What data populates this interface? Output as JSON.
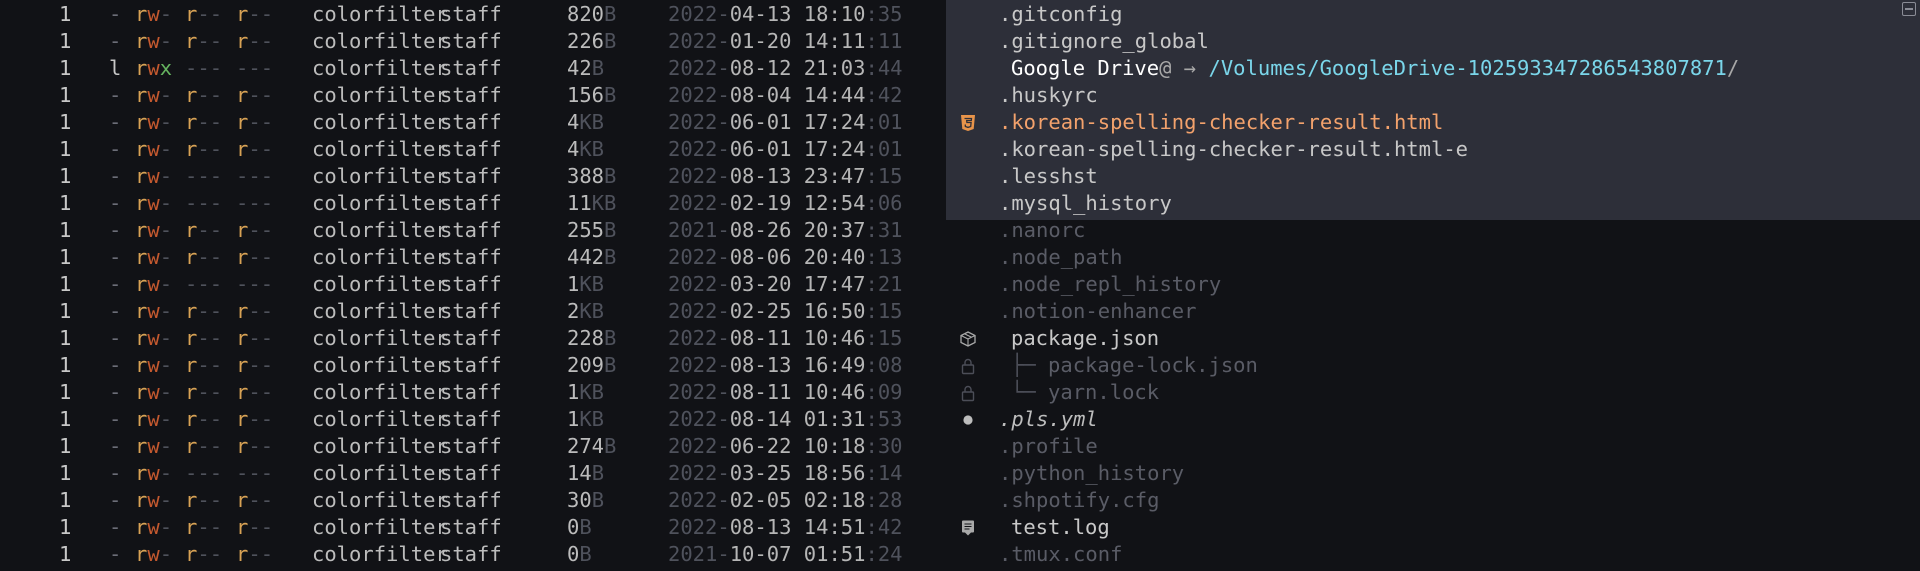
{
  "listing": [
    {
      "links": "1",
      "type": "-",
      "perm": [
        "rw-",
        "r--",
        "r--"
      ],
      "user": "colorfilter",
      "group": "staff",
      "size": "820",
      "unit": "B",
      "date_pre": "2022-",
      "date_main": "04-13 18:10",
      "date_sec": ":35",
      "icon": "none",
      "name": ".gitconfig",
      "style": "plain"
    },
    {
      "links": "1",
      "type": "-",
      "perm": [
        "rw-",
        "r--",
        "r--"
      ],
      "user": "colorfilter",
      "group": "staff",
      "size": "226",
      "unit": "B",
      "date_pre": "2022-",
      "date_main": "01-20 14:11",
      "date_sec": ":11",
      "icon": "none",
      "name": ".gitignore_global",
      "style": "plain"
    },
    {
      "links": "1",
      "type": "l",
      "perm": [
        "rwx",
        "---",
        "---"
      ],
      "user": "colorfilter",
      "group": "staff",
      "size": "42",
      "unit": "B",
      "date_pre": "2022-",
      "date_main": "08-12 21:03",
      "date_sec": ":44",
      "icon": "none",
      "name": "Google Drive",
      "link_mark": "@",
      "arrow": "→",
      "target": "/Volumes/GoogleDrive-102593347286543807871",
      "target_slash": "/",
      "style": "link"
    },
    {
      "links": "1",
      "type": "-",
      "perm": [
        "rw-",
        "r--",
        "r--"
      ],
      "user": "colorfilter",
      "group": "staff",
      "size": "156",
      "unit": "B",
      "date_pre": "2022-",
      "date_main": "08-04 14:44",
      "date_sec": ":42",
      "icon": "none",
      "name": ".huskyrc",
      "style": "plain"
    },
    {
      "links": "1",
      "type": "-",
      "perm": [
        "rw-",
        "r--",
        "r--"
      ],
      "user": "colorfilter",
      "group": "staff",
      "size": "4",
      "unit": "KB",
      "date_pre": "2022-",
      "date_main": "06-01 17:24",
      "date_sec": ":01",
      "icon": "html5-icon",
      "name": ".korean-spelling-checker-result.html",
      "style": "html"
    },
    {
      "links": "1",
      "type": "-",
      "perm": [
        "rw-",
        "r--",
        "r--"
      ],
      "user": "colorfilter",
      "group": "staff",
      "size": "4",
      "unit": "KB",
      "date_pre": "2022-",
      "date_main": "06-01 17:24",
      "date_sec": ":01",
      "icon": "none",
      "name": ".korean-spelling-checker-result.html-e",
      "style": "plain"
    },
    {
      "links": "1",
      "type": "-",
      "perm": [
        "rw-",
        "---",
        "---"
      ],
      "user": "colorfilter",
      "group": "staff",
      "size": "388",
      "unit": "B",
      "date_pre": "2022-",
      "date_main": "08-13 23:47",
      "date_sec": ":15",
      "icon": "none",
      "name": ".lesshst",
      "style": "plain"
    },
    {
      "links": "1",
      "type": "-",
      "perm": [
        "rw-",
        "---",
        "---"
      ],
      "user": "colorfilter",
      "group": "staff",
      "size": "11",
      "unit": "KB",
      "date_pre": "2022-",
      "date_main": "02-19 12:54",
      "date_sec": ":06",
      "icon": "none",
      "name": ".mysql_history",
      "style": "plain"
    },
    {
      "links": "1",
      "type": "-",
      "perm": [
        "rw-",
        "r--",
        "r--"
      ],
      "user": "colorfilter",
      "group": "staff",
      "size": "255",
      "unit": "B",
      "date_pre": "2021-",
      "date_main": "08-26 20:37",
      "date_sec": ":31",
      "icon": "none",
      "name": ".nanorc",
      "style": "dim"
    },
    {
      "links": "1",
      "type": "-",
      "perm": [
        "rw-",
        "r--",
        "r--"
      ],
      "user": "colorfilter",
      "group": "staff",
      "size": "442",
      "unit": "B",
      "date_pre": "2022-",
      "date_main": "08-06 20:40",
      "date_sec": ":13",
      "icon": "none",
      "name": ".node_path",
      "style": "dim"
    },
    {
      "links": "1",
      "type": "-",
      "perm": [
        "rw-",
        "---",
        "---"
      ],
      "user": "colorfilter",
      "group": "staff",
      "size": "1",
      "unit": "KB",
      "date_pre": "2022-",
      "date_main": "03-20 17:47",
      "date_sec": ":21",
      "icon": "none",
      "name": ".node_repl_history",
      "style": "dim"
    },
    {
      "links": "1",
      "type": "-",
      "perm": [
        "rw-",
        "r--",
        "r--"
      ],
      "user": "colorfilter",
      "group": "staff",
      "size": "2",
      "unit": "KB",
      "date_pre": "2022-",
      "date_main": "02-25 16:50",
      "date_sec": ":15",
      "icon": "none",
      "name": ".notion-enhancer",
      "style": "dim"
    },
    {
      "links": "1",
      "type": "-",
      "perm": [
        "rw-",
        "r--",
        "r--"
      ],
      "user": "colorfilter",
      "group": "staff",
      "size": "228",
      "unit": "B",
      "date_pre": "2022-",
      "date_main": "08-11 10:46",
      "date_sec": ":15",
      "icon": "package-icon",
      "name": "package.json",
      "style": "plain"
    },
    {
      "links": "1",
      "type": "-",
      "perm": [
        "rw-",
        "r--",
        "r--"
      ],
      "user": "colorfilter",
      "group": "staff",
      "size": "209",
      "unit": "B",
      "date_pre": "2022-",
      "date_main": "08-13 16:49",
      "date_sec": ":08",
      "icon": "lock-icon",
      "tree": "├─",
      "name": "package-lock.json",
      "style": "tree"
    },
    {
      "links": "1",
      "type": "-",
      "perm": [
        "rw-",
        "r--",
        "r--"
      ],
      "user": "colorfilter",
      "group": "staff",
      "size": "1",
      "unit": "KB",
      "date_pre": "2022-",
      "date_main": "08-11 10:46",
      "date_sec": ":09",
      "icon": "lock-icon",
      "tree": "└─",
      "name": "yarn.lock",
      "style": "tree"
    },
    {
      "links": "1",
      "type": "-",
      "perm": [
        "rw-",
        "r--",
        "r--"
      ],
      "user": "colorfilter",
      "group": "staff",
      "size": "1",
      "unit": "KB",
      "date_pre": "2022-",
      "date_main": "08-14 01:31",
      "date_sec": ":53",
      "icon": "dot-icon",
      "name": ".pls.yml",
      "style": "italic"
    },
    {
      "links": "1",
      "type": "-",
      "perm": [
        "rw-",
        "r--",
        "r--"
      ],
      "user": "colorfilter",
      "group": "staff",
      "size": "274",
      "unit": "B",
      "date_pre": "2022-",
      "date_main": "06-22 10:18",
      "date_sec": ":30",
      "icon": "none",
      "name": ".profile",
      "style": "dim"
    },
    {
      "links": "1",
      "type": "-",
      "perm": [
        "rw-",
        "---",
        "---"
      ],
      "user": "colorfilter",
      "group": "staff",
      "size": "14",
      "unit": "B",
      "date_pre": "2022-",
      "date_main": "03-25 18:56",
      "date_sec": ":14",
      "icon": "none",
      "name": ".python_history",
      "style": "dim"
    },
    {
      "links": "1",
      "type": "-",
      "perm": [
        "rw-",
        "r--",
        "r--"
      ],
      "user": "colorfilter",
      "group": "staff",
      "size": "30",
      "unit": "B",
      "date_pre": "2022-",
      "date_main": "02-05 02:18",
      "date_sec": ":28",
      "icon": "none",
      "name": ".shpotify.cfg",
      "style": "dim"
    },
    {
      "links": "1",
      "type": "-",
      "perm": [
        "rw-",
        "r--",
        "r--"
      ],
      "user": "colorfilter",
      "group": "staff",
      "size": "0",
      "unit": "B",
      "date_pre": "2022-",
      "date_main": "08-13 14:51",
      "date_sec": ":42",
      "icon": "log-icon",
      "name": "test.log",
      "style": "plain"
    },
    {
      "links": "1",
      "type": "-",
      "perm": [
        "rw-",
        "r--",
        "r--"
      ],
      "user": "colorfilter",
      "group": "staff",
      "size": "0",
      "unit": "B",
      "date_pre": "2021-",
      "date_main": "10-07 01:51",
      "date_sec": ":24",
      "icon": "none",
      "name": ".tmux.conf",
      "style": "dim"
    }
  ],
  "colors": {
    "background": "#111216",
    "selection": "#2d2f39",
    "perm_read": "#d8a255",
    "perm_write": "#c4592f",
    "perm_exec": "#65b35f",
    "html_file": "#f3a26c",
    "symlink_target": "#7ad6ea"
  }
}
